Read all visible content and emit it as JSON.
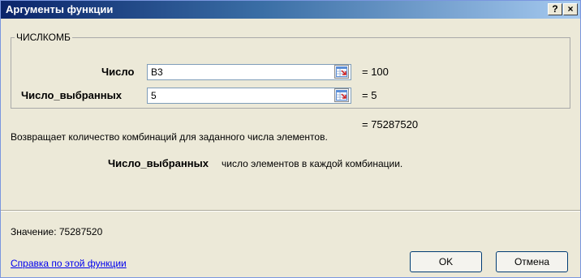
{
  "window": {
    "title": "Аргументы функции",
    "help_glyph": "?",
    "close_glyph": "×"
  },
  "function": {
    "name": "ЧИСЛКОМБ",
    "args": [
      {
        "label": "Число",
        "value": "B3",
        "result": "=  100"
      },
      {
        "label": "Число_выбранных",
        "value": "5",
        "result": "=  5"
      }
    ],
    "result": "=  75287520",
    "description": "Возвращает количество комбинаций для заданного числа элементов.",
    "arg_help_name": "Число_выбранных",
    "arg_help_text": "число элементов в каждой комбинации."
  },
  "footer": {
    "value_text": "Значение:  75287520",
    "help_link": "Справка по этой функции",
    "ok_label": "OK",
    "cancel_label": "Отмена"
  },
  "icons": {
    "ref_button": "collapse-dialog-icon"
  }
}
